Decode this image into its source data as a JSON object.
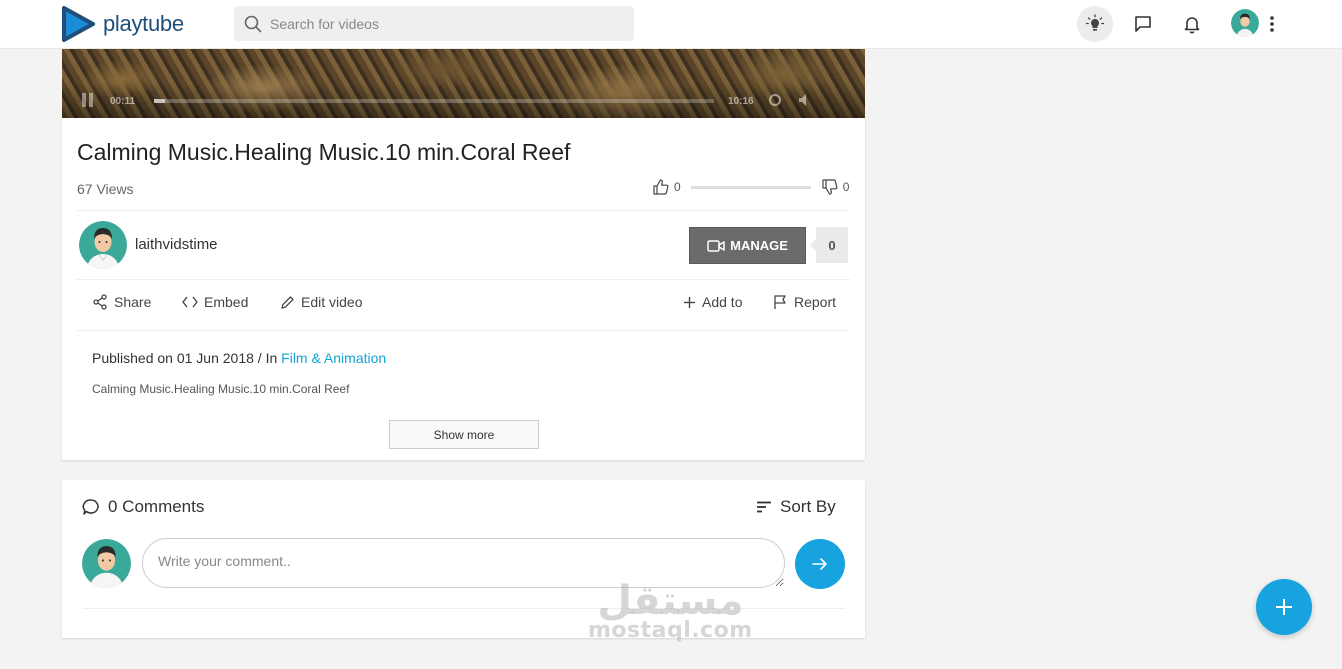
{
  "header": {
    "logo_text": "playtube",
    "search_placeholder": "Search for videos",
    "icons": [
      "lightbulb-icon",
      "chat-icon",
      "bell-icon",
      "avatar",
      "more-vertical-icon"
    ]
  },
  "player": {
    "current_time": "00:11",
    "duration": "10:16",
    "progress": 0.02
  },
  "video": {
    "title": "Calming Music.Healing Music.10 min.Coral Reef",
    "views": "67 Views",
    "likes": "0",
    "dislikes": "0",
    "channel_name": "laithvidstime",
    "manage_label": "MANAGE",
    "subscriber_count": "0",
    "published_prefix": "Published on 01 Jun 2018 / In ",
    "category": "Film & Animation",
    "description": "Calming Music.Healing Music.10 min.Coral Reef",
    "show_more_label": "Show more"
  },
  "actions": {
    "share": "Share",
    "embed": "Embed",
    "edit": "Edit video",
    "add_to": "Add to",
    "report": "Report"
  },
  "comments": {
    "count_label": "0 Comments",
    "sort_label": "Sort By",
    "input_placeholder": "Write your comment.."
  },
  "watermark": {
    "arabic": "مستقل",
    "latin": "mostaql.com"
  },
  "colors": {
    "accent": "#16a3e0",
    "link": "#14a3d6",
    "manage_bg": "#6b6b6b"
  }
}
